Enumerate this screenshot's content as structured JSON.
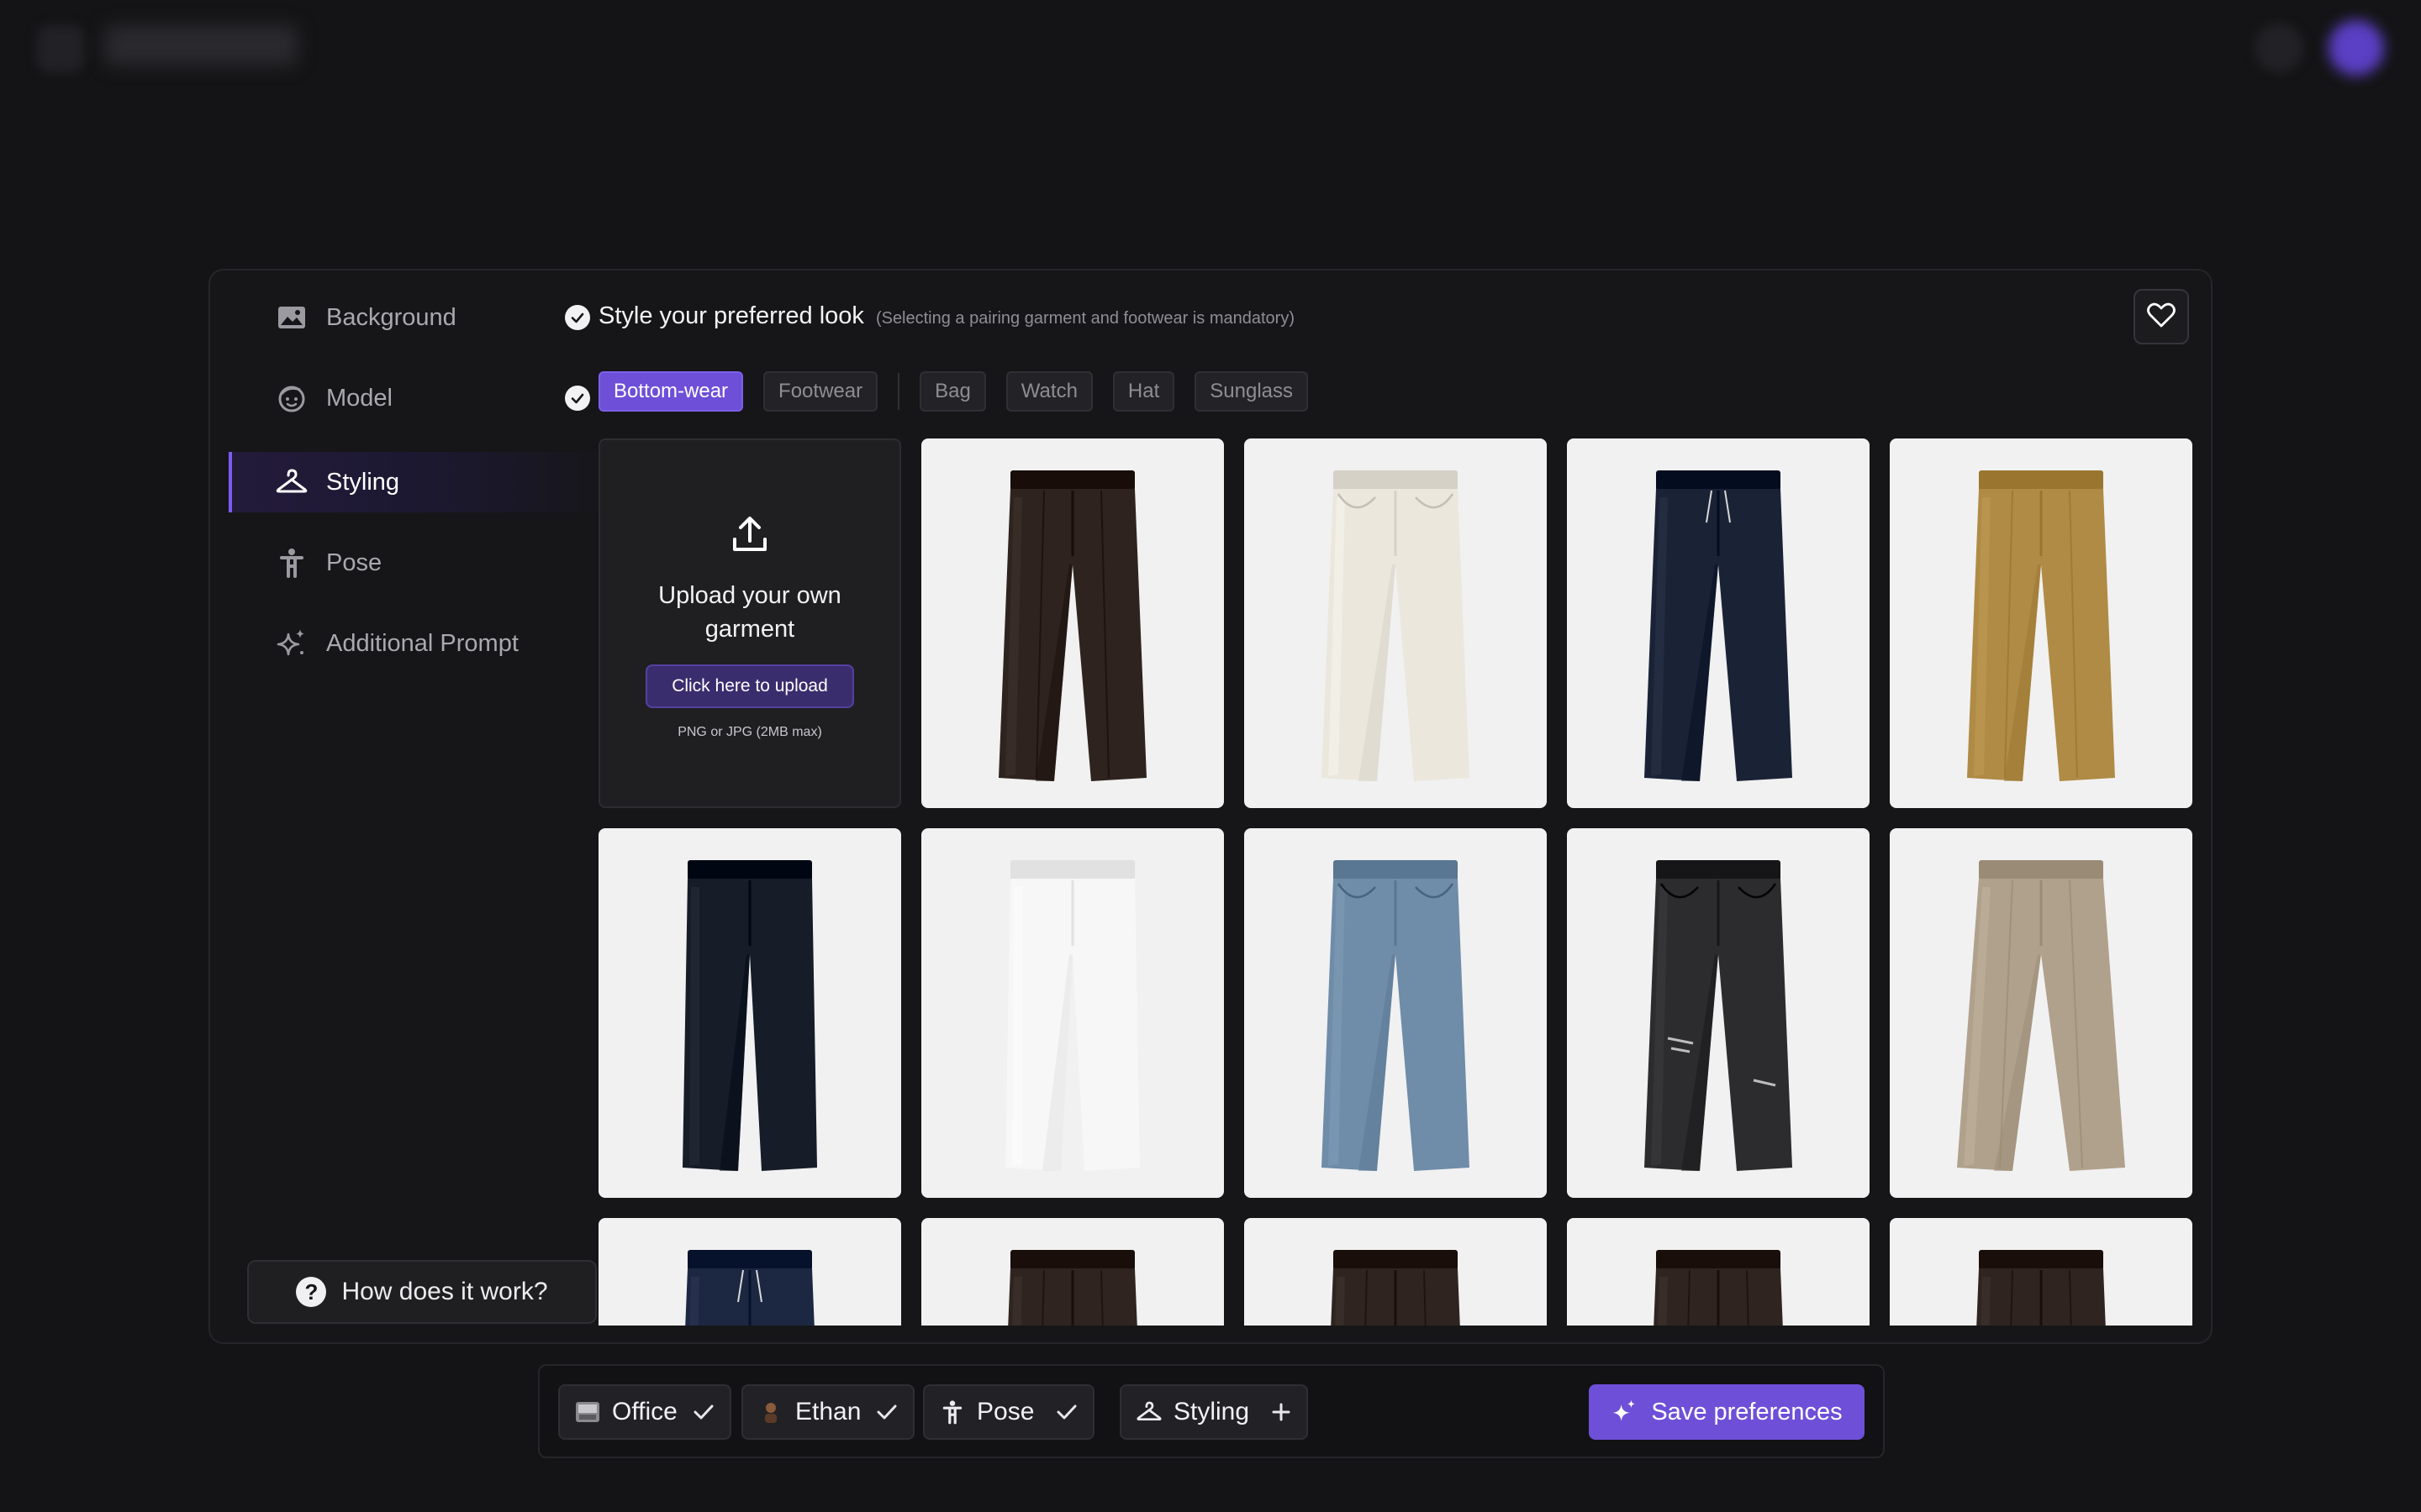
{
  "sidebar": {
    "items": [
      {
        "label": "Background",
        "icon": "image-icon",
        "done": true
      },
      {
        "label": "Model",
        "icon": "face-icon",
        "done": true
      },
      {
        "label": "Styling",
        "icon": "hanger-icon",
        "active": true
      },
      {
        "label": "Pose",
        "icon": "person-icon"
      },
      {
        "label": "Additional Prompt",
        "icon": "sparkle-icon"
      }
    ],
    "help_label": "How does it work?"
  },
  "header": {
    "title": "Style your preferred look",
    "subtitle": "(Selecting a pairing garment and footwear is mandatory)"
  },
  "tabs": [
    {
      "label": "Bottom-wear",
      "active": true
    },
    {
      "label": "Footwear"
    },
    {
      "label": "Bag"
    },
    {
      "label": "Watch"
    },
    {
      "label": "Hat"
    },
    {
      "label": "Sunglass"
    }
  ],
  "upload": {
    "title": "Upload your own garment",
    "button": "Click here to upload",
    "hint": "PNG or JPG (2MB max)"
  },
  "garments": [
    {
      "color": "#2e231e",
      "style": "pleated"
    },
    {
      "color": "#ebe7dc",
      "style": "jeans"
    },
    {
      "color": "#1a2336",
      "style": "drawstring"
    },
    {
      "color": "#b08b45",
      "style": "pleated"
    },
    {
      "color": "#161c28",
      "style": "slim"
    },
    {
      "color": "#f7f7f7",
      "style": "slim"
    },
    {
      "color": "#6f8ca8",
      "style": "jeans"
    },
    {
      "color": "#2c2c2e",
      "style": "ripped"
    },
    {
      "color": "#b0a18c",
      "style": "wide"
    },
    {
      "color": "#1c2742",
      "style": "drawstring"
    },
    {
      "color": "#2f2420",
      "style": "pleated"
    },
    {
      "color": "#2f2420",
      "style": "pleated"
    },
    {
      "color": "#2f2420",
      "style": "pleated"
    },
    {
      "color": "#2f2420",
      "style": "pleated"
    }
  ],
  "bottombar": {
    "chips": [
      {
        "label": "Office",
        "icon": "office-thumbnail-icon",
        "mark": "check"
      },
      {
        "label": "Ethan",
        "icon": "avatar-icon",
        "mark": "check"
      },
      {
        "label": "Pose",
        "icon": "person-icon",
        "mark": "check"
      },
      {
        "label": "Styling",
        "icon": "hanger-icon",
        "mark": "plus"
      }
    ],
    "save_label": "Save preferences"
  },
  "colors": {
    "accent": "#6e4fd8",
    "background": "#141416",
    "panel": "#161618"
  }
}
